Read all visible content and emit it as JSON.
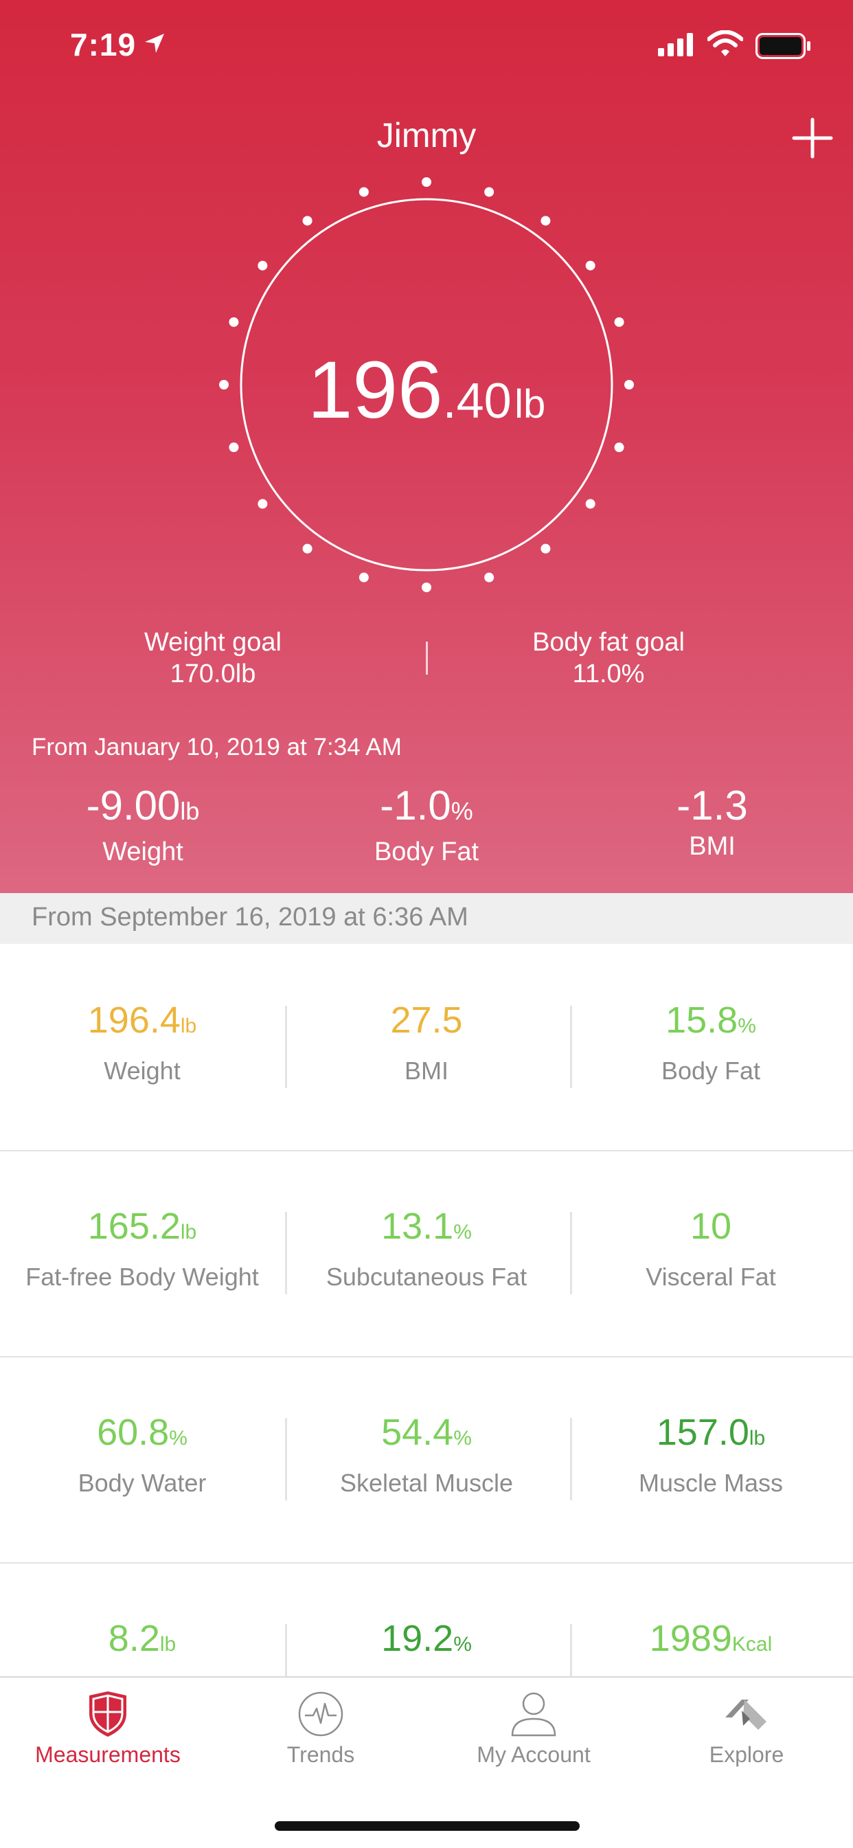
{
  "status_bar": {
    "time": "7:19"
  },
  "header": {
    "title": "Jimmy"
  },
  "current_weight": {
    "integer": "196",
    "decimal": ".40",
    "unit": "lb"
  },
  "goals": {
    "weight": {
      "label": "Weight goal",
      "value": "170.0lb"
    },
    "body_fat": {
      "label": "Body fat goal",
      "value": "11.0%"
    }
  },
  "changes": {
    "since": "From January 10, 2019 at 7:34 AM",
    "items": [
      {
        "value": "-9.00",
        "unit": "lb",
        "label": "Weight"
      },
      {
        "value": "-1.0",
        "unit": "%",
        "label": "Body Fat"
      },
      {
        "value": "-1.3",
        "unit": "",
        "label": "BMI"
      }
    ]
  },
  "measurements": {
    "since": "From September 16, 2019 at 6:36 AM",
    "rows": [
      [
        {
          "value": "196.4",
          "unit": "lb",
          "label": "Weight",
          "color": "#ecb53c"
        },
        {
          "value": "27.5",
          "unit": "",
          "label": "BMI",
          "color": "#ecb53c"
        },
        {
          "value": "15.8",
          "unit": "%",
          "label": "Body Fat",
          "color": "#7ccf5a"
        }
      ],
      [
        {
          "value": "165.2",
          "unit": "lb",
          "label": "Fat-free Body Weight",
          "color": "#7ccf5a"
        },
        {
          "value": "13.1",
          "unit": "%",
          "label": "Subcutaneous Fat",
          "color": "#7ccf5a"
        },
        {
          "value": "10",
          "unit": "",
          "label": "Visceral Fat",
          "color": "#7ccf5a"
        }
      ],
      [
        {
          "value": "60.8",
          "unit": "%",
          "label": "Body Water",
          "color": "#7ccf5a"
        },
        {
          "value": "54.4",
          "unit": "%",
          "label": "Skeletal Muscle",
          "color": "#7ccf5a"
        },
        {
          "value": "157.0",
          "unit": "lb",
          "label": "Muscle Mass",
          "color": "#3ea23a"
        }
      ],
      [
        {
          "value": "8.2",
          "unit": "lb",
          "label": "",
          "color": "#7ccf5a"
        },
        {
          "value": "19.2",
          "unit": "%",
          "label": "",
          "color": "#3ea23a"
        },
        {
          "value": "1989",
          "unit": "Kcal",
          "label": "",
          "color": "#7ccf5a"
        }
      ]
    ]
  },
  "tabs": [
    {
      "label": "Measurements",
      "icon": "shield-icon",
      "active": true
    },
    {
      "label": "Trends",
      "icon": "heartbeat-icon",
      "active": false
    },
    {
      "label": "My Account",
      "icon": "person-icon",
      "active": false
    },
    {
      "label": "Explore",
      "icon": "explore-icon",
      "active": false
    }
  ],
  "colors": {
    "brand": "#d3283f",
    "yellow": "#ecb53c",
    "green": "#7ccf5a",
    "dark_green": "#3ea23a"
  }
}
